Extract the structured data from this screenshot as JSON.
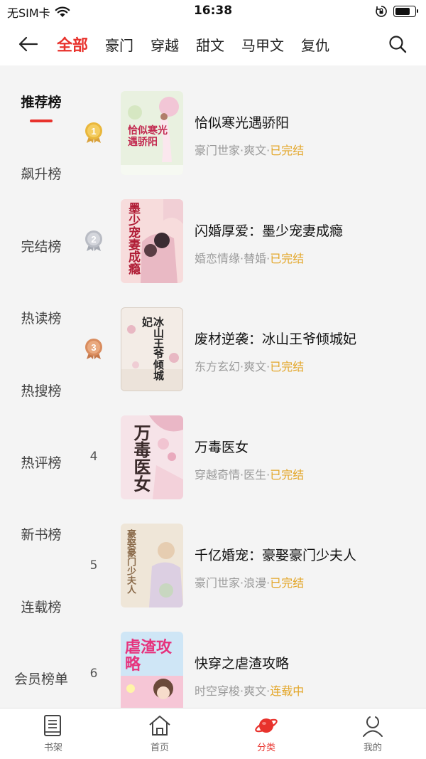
{
  "status": {
    "carrier": "无SIM卡",
    "time": "16:38",
    "battery_level": 0.75
  },
  "nav": {
    "tabs": [
      {
        "label": "全部",
        "active": true
      },
      {
        "label": "豪门"
      },
      {
        "label": "穿越"
      },
      {
        "label": "甜文"
      },
      {
        "label": "马甲文"
      },
      {
        "label": "复仇"
      }
    ],
    "icons": {
      "back": "back-arrow-icon",
      "search": "search-icon"
    }
  },
  "sidebar": {
    "items": [
      {
        "label": "推荐榜",
        "active": true
      },
      {
        "label": "飙升榜"
      },
      {
        "label": "完结榜"
      },
      {
        "label": "热读榜"
      },
      {
        "label": "热搜榜"
      },
      {
        "label": "热评榜"
      },
      {
        "label": "新书榜"
      },
      {
        "label": "连载榜"
      },
      {
        "label": "会员榜单"
      }
    ]
  },
  "books": [
    {
      "rank": "1",
      "title": "恰似寒光遇骄阳",
      "genre": "豪门世家",
      "tag": "爽文",
      "status": "已完结",
      "cover_text": "恰似寒光遇骄阳",
      "cover_color": "#e9f1e0"
    },
    {
      "rank": "2",
      "title": "闪婚厚爱：墨少宠妻成瘾",
      "genre": "婚恋情缘",
      "tag": "替婚",
      "status": "已完结",
      "cover_text": "墨少宠妻成瘾",
      "cover_color": "#f7dcdc"
    },
    {
      "rank": "3",
      "title": "废材逆袭：冰山王爷倾城妃",
      "genre": "东方玄幻",
      "tag": "爽文",
      "status": "已完结",
      "cover_text": "冰山王爷倾城妃",
      "cover_color": "#f3ece6"
    },
    {
      "rank": "4",
      "title": "万毒医女",
      "genre": "穿越奇情",
      "tag": "医生",
      "status": "已完结",
      "cover_text": "万毒医女",
      "cover_color": "#f6e3e8"
    },
    {
      "rank": "5",
      "title": "千亿婚宠：豪娶豪门少夫人",
      "genre": "豪门世家",
      "tag": "浪漫",
      "status": "已完结",
      "cover_text": "豪娶豪门少夫人",
      "cover_color": "#efe6d8"
    },
    {
      "rank": "6",
      "title": "快穿之虐渣攻略",
      "genre": "时空穿梭",
      "tag": "爽文",
      "status": "连载中",
      "cover_text": "虐渣攻略",
      "cover_color": "#cfe6f6"
    }
  ],
  "meta_separator": "·",
  "tabbar": {
    "items": [
      {
        "label": "书架",
        "icon": "bookshelf-icon"
      },
      {
        "label": "首页",
        "icon": "home-icon"
      },
      {
        "label": "分类",
        "icon": "planet-icon",
        "active": true
      },
      {
        "label": "我的",
        "icon": "profile-icon"
      }
    ]
  },
  "colors": {
    "accent": "#e8322c",
    "status": "#e3a628",
    "gold": "#e9b73c",
    "silver": "#b9bcc4",
    "bronze": "#d98c5e"
  }
}
